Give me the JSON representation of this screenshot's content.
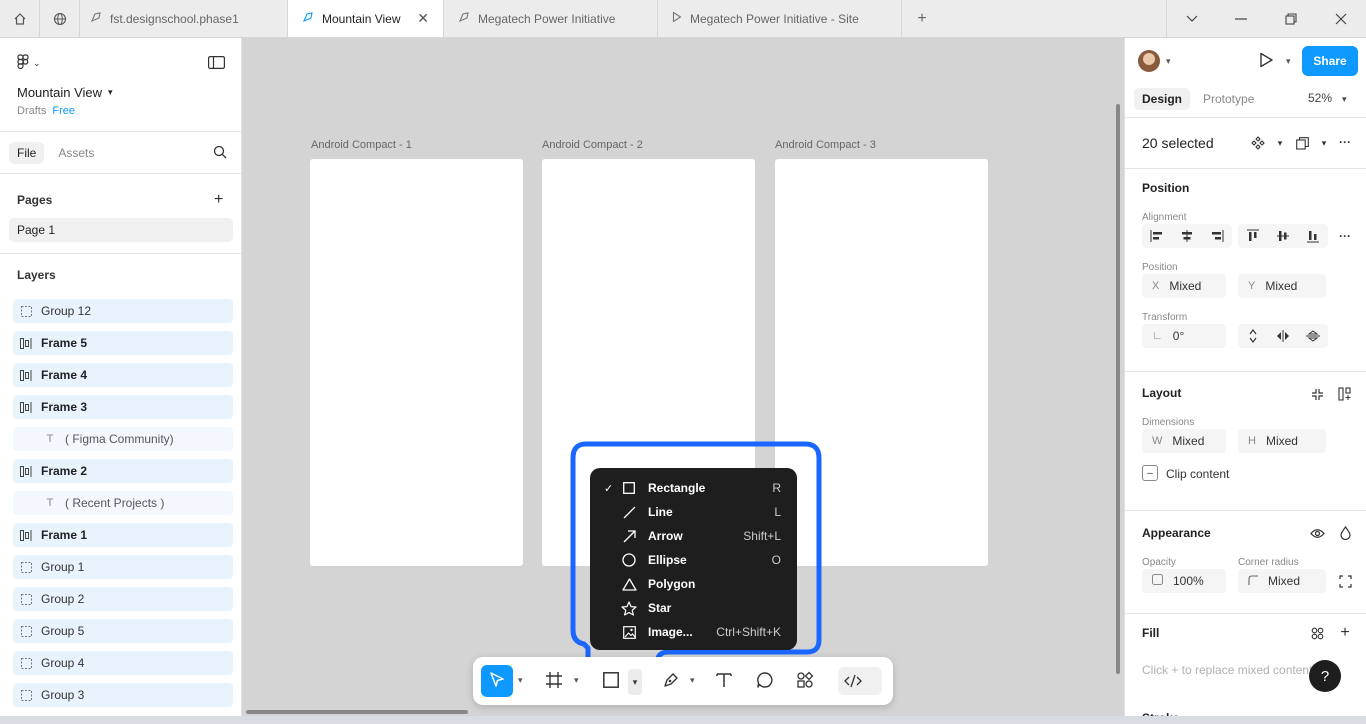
{
  "browser": {
    "tabs": [
      {
        "label": "fst.designschool.phase1",
        "icon": "figma-file-icon"
      },
      {
        "label": "Mountain View",
        "icon": "figma-file-icon",
        "active": true
      },
      {
        "label": "Megatech Power Initiative",
        "icon": "figma-file-icon"
      },
      {
        "label": "Megatech Power Initiative - Site",
        "icon": "play-icon"
      }
    ]
  },
  "file": {
    "title": "Mountain View",
    "location": "Drafts",
    "plan": "Free"
  },
  "left_panel": {
    "tabs": [
      "File",
      "Assets"
    ],
    "pages_header": "Pages",
    "pages": [
      "Page 1"
    ],
    "layers_header": "Layers",
    "layers": [
      {
        "name": "Group 12",
        "type": "group"
      },
      {
        "name": "Frame 5",
        "type": "frame"
      },
      {
        "name": "Frame 4",
        "type": "frame"
      },
      {
        "name": "Frame 3",
        "type": "frame"
      },
      {
        "name": "( Figma Community)",
        "type": "text"
      },
      {
        "name": "Frame 2",
        "type": "frame"
      },
      {
        "name": "( Recent Projects )",
        "type": "text"
      },
      {
        "name": "Frame 1",
        "type": "frame"
      },
      {
        "name": "Group 1",
        "type": "group"
      },
      {
        "name": "Group 2",
        "type": "group"
      },
      {
        "name": "Group 5",
        "type": "group"
      },
      {
        "name": "Group 4",
        "type": "group"
      },
      {
        "name": "Group 3",
        "type": "group"
      }
    ]
  },
  "canvas": {
    "frames": [
      "Android Compact - 1",
      "Android Compact - 2",
      "Android Compact - 3"
    ]
  },
  "shape_menu": {
    "items": [
      {
        "label": "Rectangle",
        "shortcut": "R",
        "icon": "rectangle-icon",
        "checked": true
      },
      {
        "label": "Line",
        "shortcut": "L",
        "icon": "line-icon"
      },
      {
        "label": "Arrow",
        "shortcut": "Shift+L",
        "icon": "arrow-icon"
      },
      {
        "label": "Ellipse",
        "shortcut": "O",
        "icon": "ellipse-icon"
      },
      {
        "label": "Polygon",
        "shortcut": "",
        "icon": "polygon-icon"
      },
      {
        "label": "Star",
        "shortcut": "",
        "icon": "star-icon"
      },
      {
        "label": "Image...",
        "shortcut": "Ctrl+Shift+K",
        "icon": "image-icon"
      }
    ]
  },
  "right_panel": {
    "share_label": "Share",
    "tabs": [
      "Design",
      "Prototype"
    ],
    "zoom": "52%",
    "selection": "20 selected",
    "position": {
      "title": "Position",
      "alignment_label": "Alignment",
      "position_label": "Position",
      "x_label": "X",
      "x_value": "Mixed",
      "y_label": "Y",
      "y_value": "Mixed",
      "transform_label": "Transform",
      "rotation": "0°"
    },
    "layout": {
      "title": "Layout",
      "dimensions_label": "Dimensions",
      "w_label": "W",
      "w_value": "Mixed",
      "h_label": "H",
      "h_value": "Mixed",
      "clip_label": "Clip content"
    },
    "appearance": {
      "title": "Appearance",
      "opacity_label": "Opacity",
      "opacity_value": "100%",
      "radius_label": "Corner radius",
      "radius_value": "Mixed"
    },
    "fill": {
      "title": "Fill",
      "placeholder": "Click + to replace mixed content"
    },
    "stroke": {
      "title": "Stroke"
    },
    "help": "?"
  },
  "colors": {
    "accent": "#0d99ff",
    "highlight": "#1a66ff",
    "menu_bg": "#1e1e1e",
    "selection_row": "#e8f3fd"
  }
}
